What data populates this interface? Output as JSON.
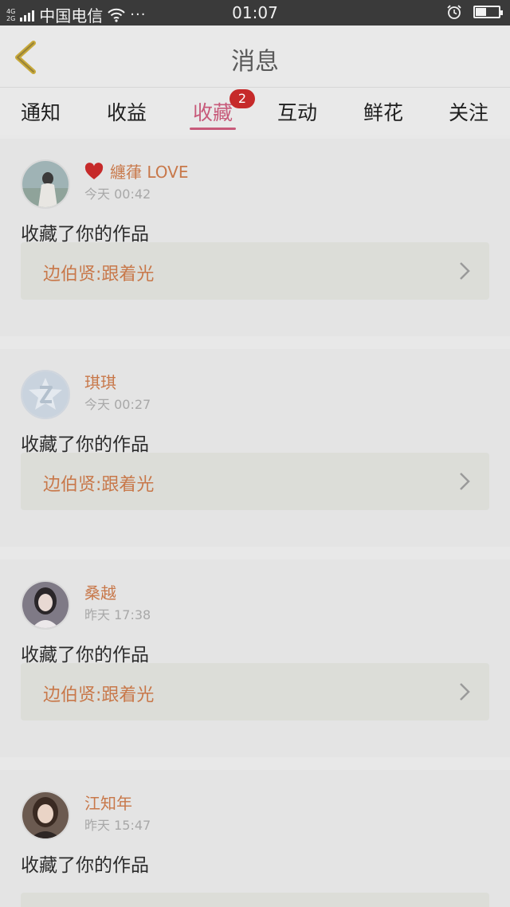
{
  "status_bar": {
    "network_top": "4G",
    "network_bottom": "2G",
    "carrier": "中国电信",
    "more": "···",
    "time": "01:07",
    "battery_level": 0.45,
    "icons": [
      "signal-icon",
      "wifi-icon",
      "alarm-icon",
      "battery-icon"
    ]
  },
  "header": {
    "title": "消息",
    "back_icon": "chevron-left-icon"
  },
  "tabs": [
    {
      "label": "通知"
    },
    {
      "label": "收益"
    },
    {
      "label": "收藏",
      "badge": "2",
      "active": true
    },
    {
      "label": "互动"
    },
    {
      "label": "鲜花"
    },
    {
      "label": "关注"
    }
  ],
  "colors": {
    "accent": "#c75a7a",
    "name_color": "#c8784a",
    "badge_bg": "#c62a2a"
  },
  "messages": [
    {
      "username": "纏葎 LOVE",
      "has_heart": true,
      "time": "今天 00:42",
      "action": "收藏了你的作品",
      "work": "边伯贤:跟着光"
    },
    {
      "username": "琪琪",
      "has_heart": false,
      "time": "今天 00:27",
      "action": "收藏了你的作品",
      "work": "边伯贤:跟着光"
    },
    {
      "username": "桑越",
      "has_heart": false,
      "time": "昨天 17:38",
      "action": "收藏了你的作品",
      "work": "边伯贤:跟着光"
    },
    {
      "username": "江知年",
      "has_heart": false,
      "time": "昨天 15:47",
      "action": "收藏了你的作品",
      "work": ""
    }
  ]
}
